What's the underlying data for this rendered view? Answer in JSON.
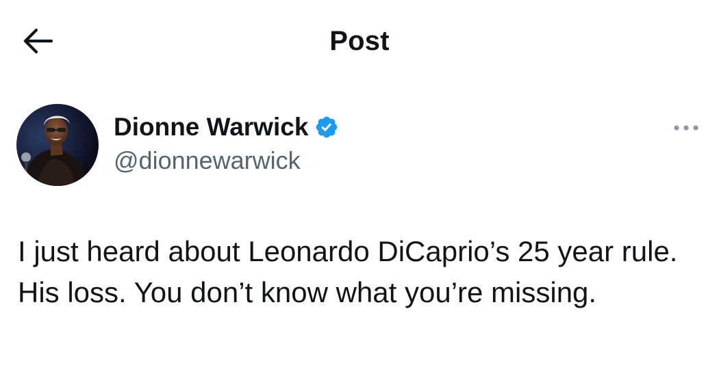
{
  "header": {
    "title": "Post",
    "back_icon": "arrow-left-icon"
  },
  "author": {
    "display_name": "Dionne Warwick",
    "handle": "@dionnewarwick",
    "verified": true,
    "verified_icon": "verified-badge-icon",
    "verified_color": "#1d9bf0",
    "avatar_icon": "profile-photo"
  },
  "menu": {
    "more_icon": "more-horizontal-icon"
  },
  "tweet": {
    "text": "I just heard about Leonardo DiCaprio’s 25 year rule. His loss. You don’t know what you’re missing."
  },
  "colors": {
    "text_primary": "#0f1419",
    "text_secondary": "#536471",
    "background": "#ffffff"
  }
}
